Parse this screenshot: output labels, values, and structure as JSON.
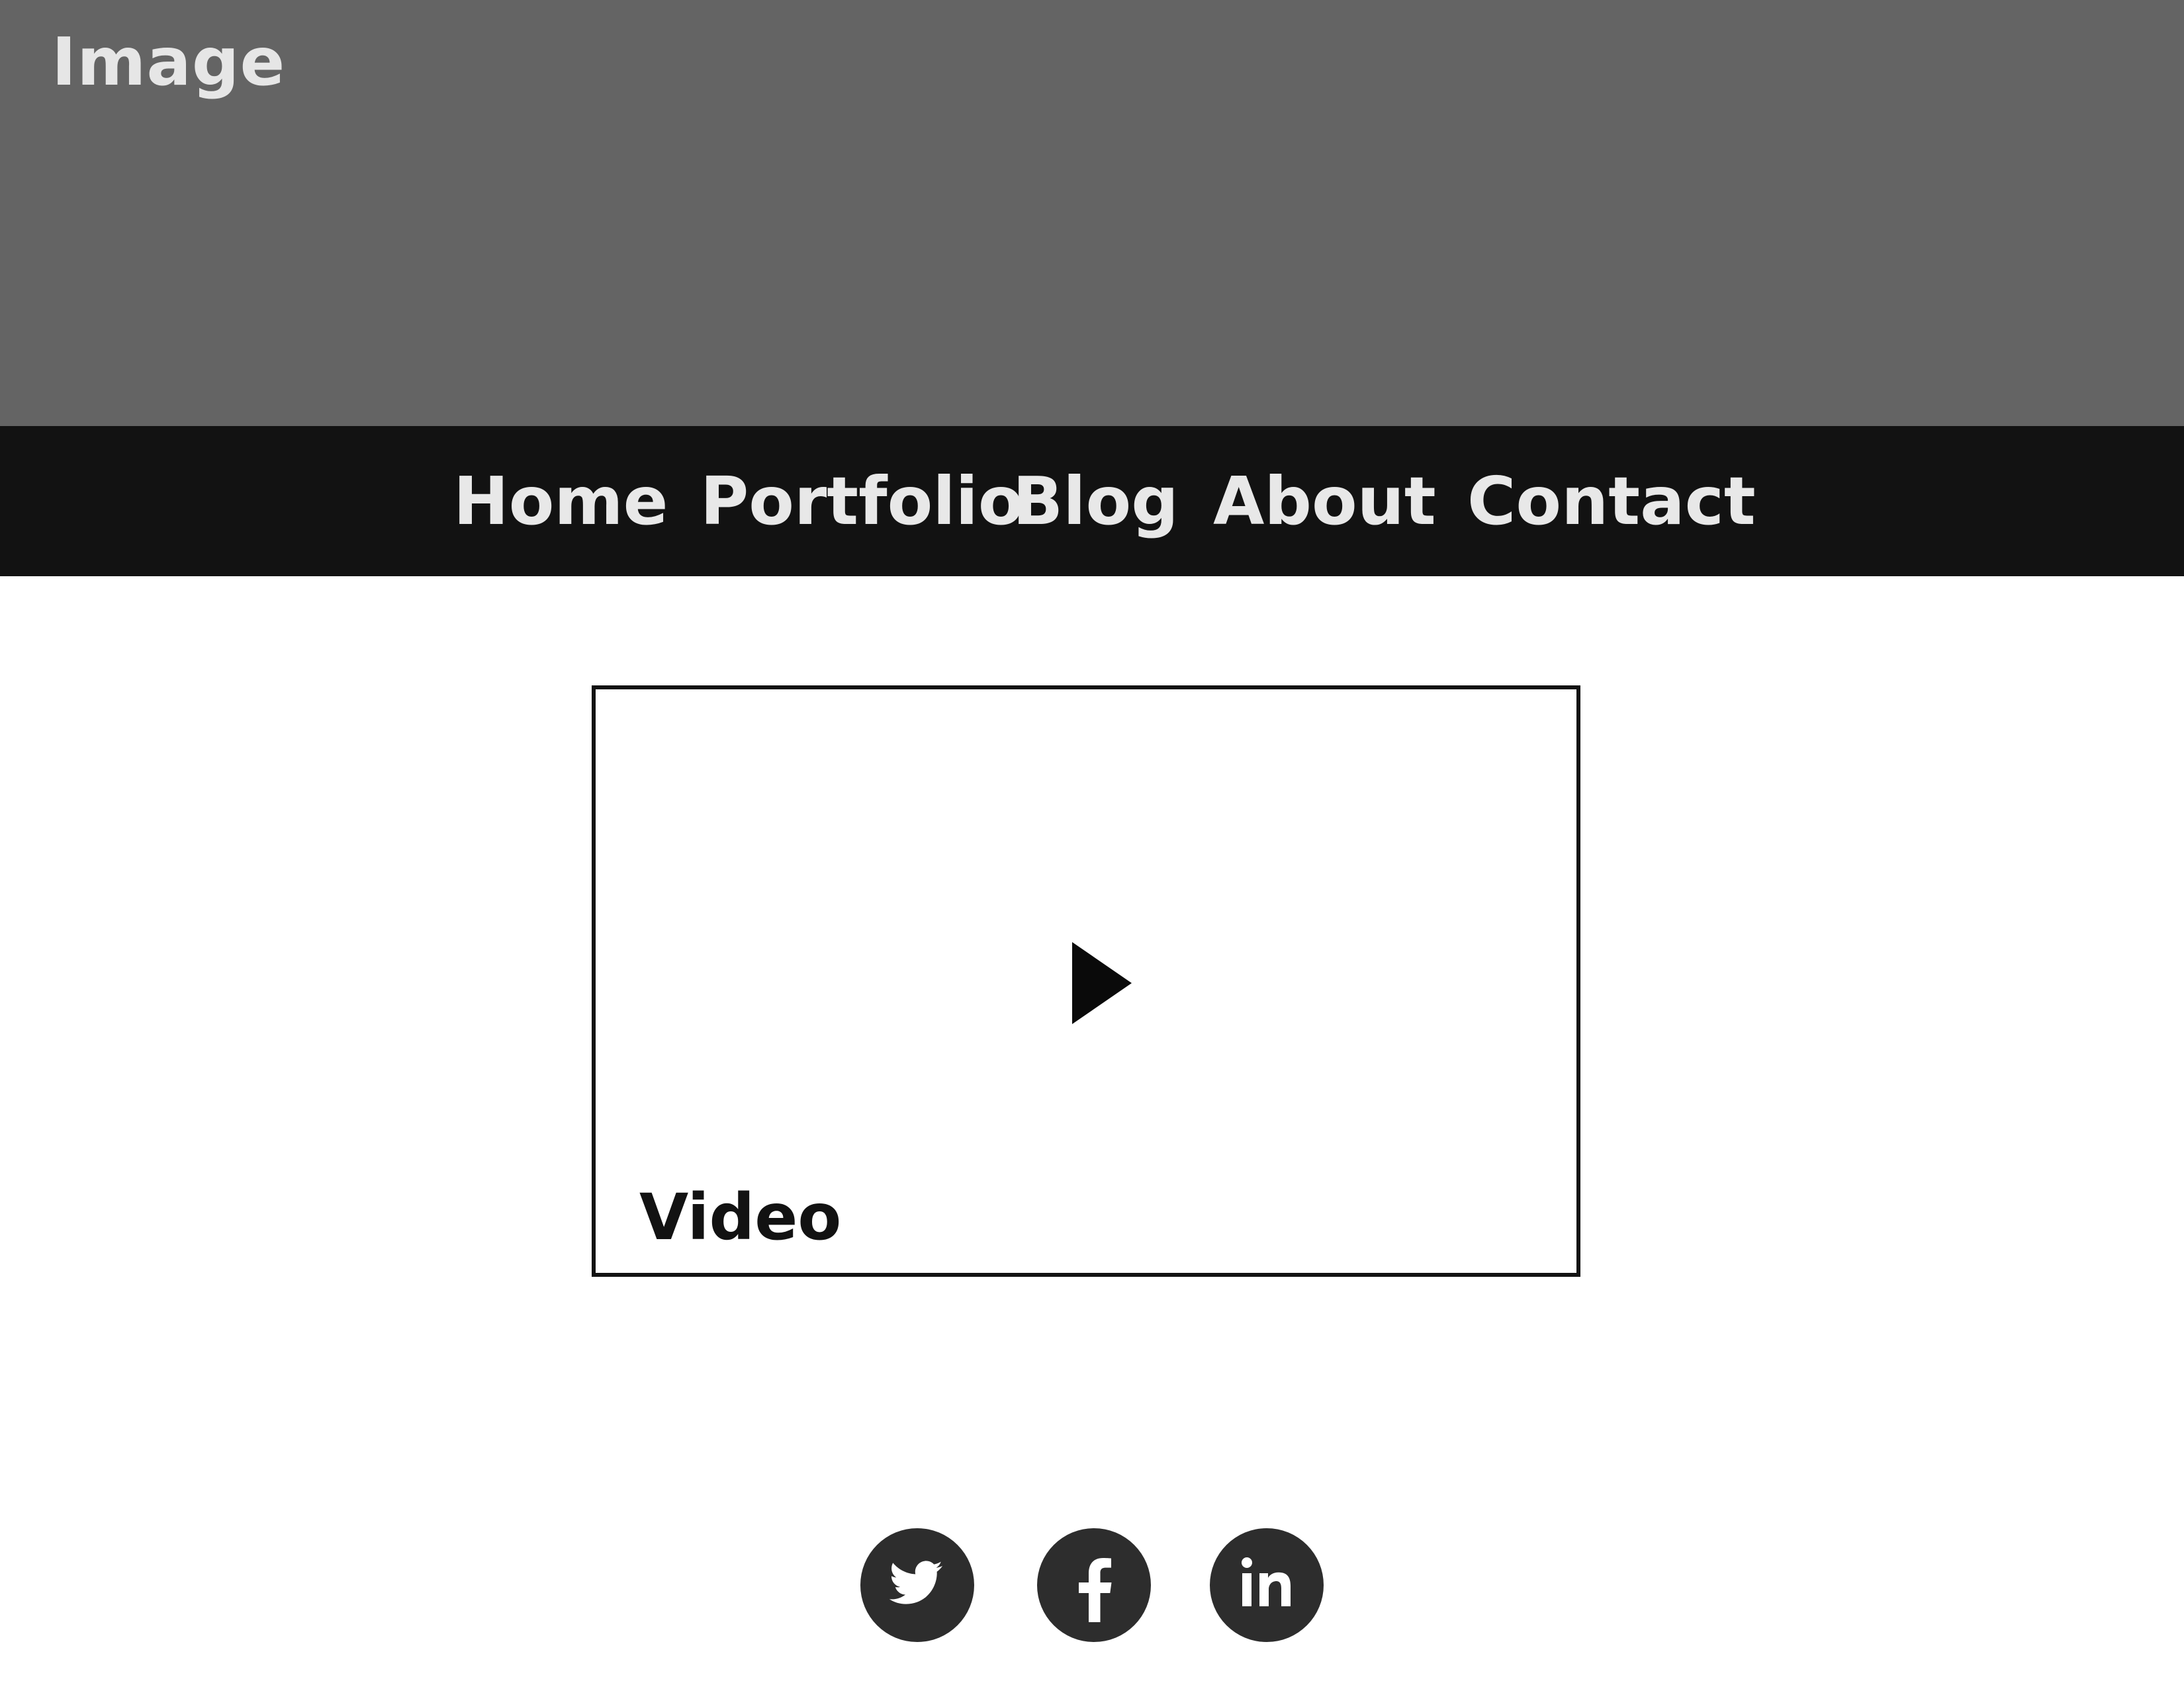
{
  "hero": {
    "label": "Image",
    "background_color": "#646464"
  },
  "nav": {
    "background_color": "#121212",
    "items": [
      {
        "label": "Home"
      },
      {
        "label": "Portfolio"
      },
      {
        "label": "Blog"
      },
      {
        "label": "About"
      },
      {
        "label": "Contact"
      }
    ]
  },
  "video": {
    "label": "Video",
    "icon": "play-icon"
  },
  "social": {
    "icon_color": "#2d2d2d",
    "links": [
      {
        "icon": "twitter-icon"
      },
      {
        "icon": "facebook-icon"
      },
      {
        "icon": "linkedin-icon"
      }
    ]
  }
}
